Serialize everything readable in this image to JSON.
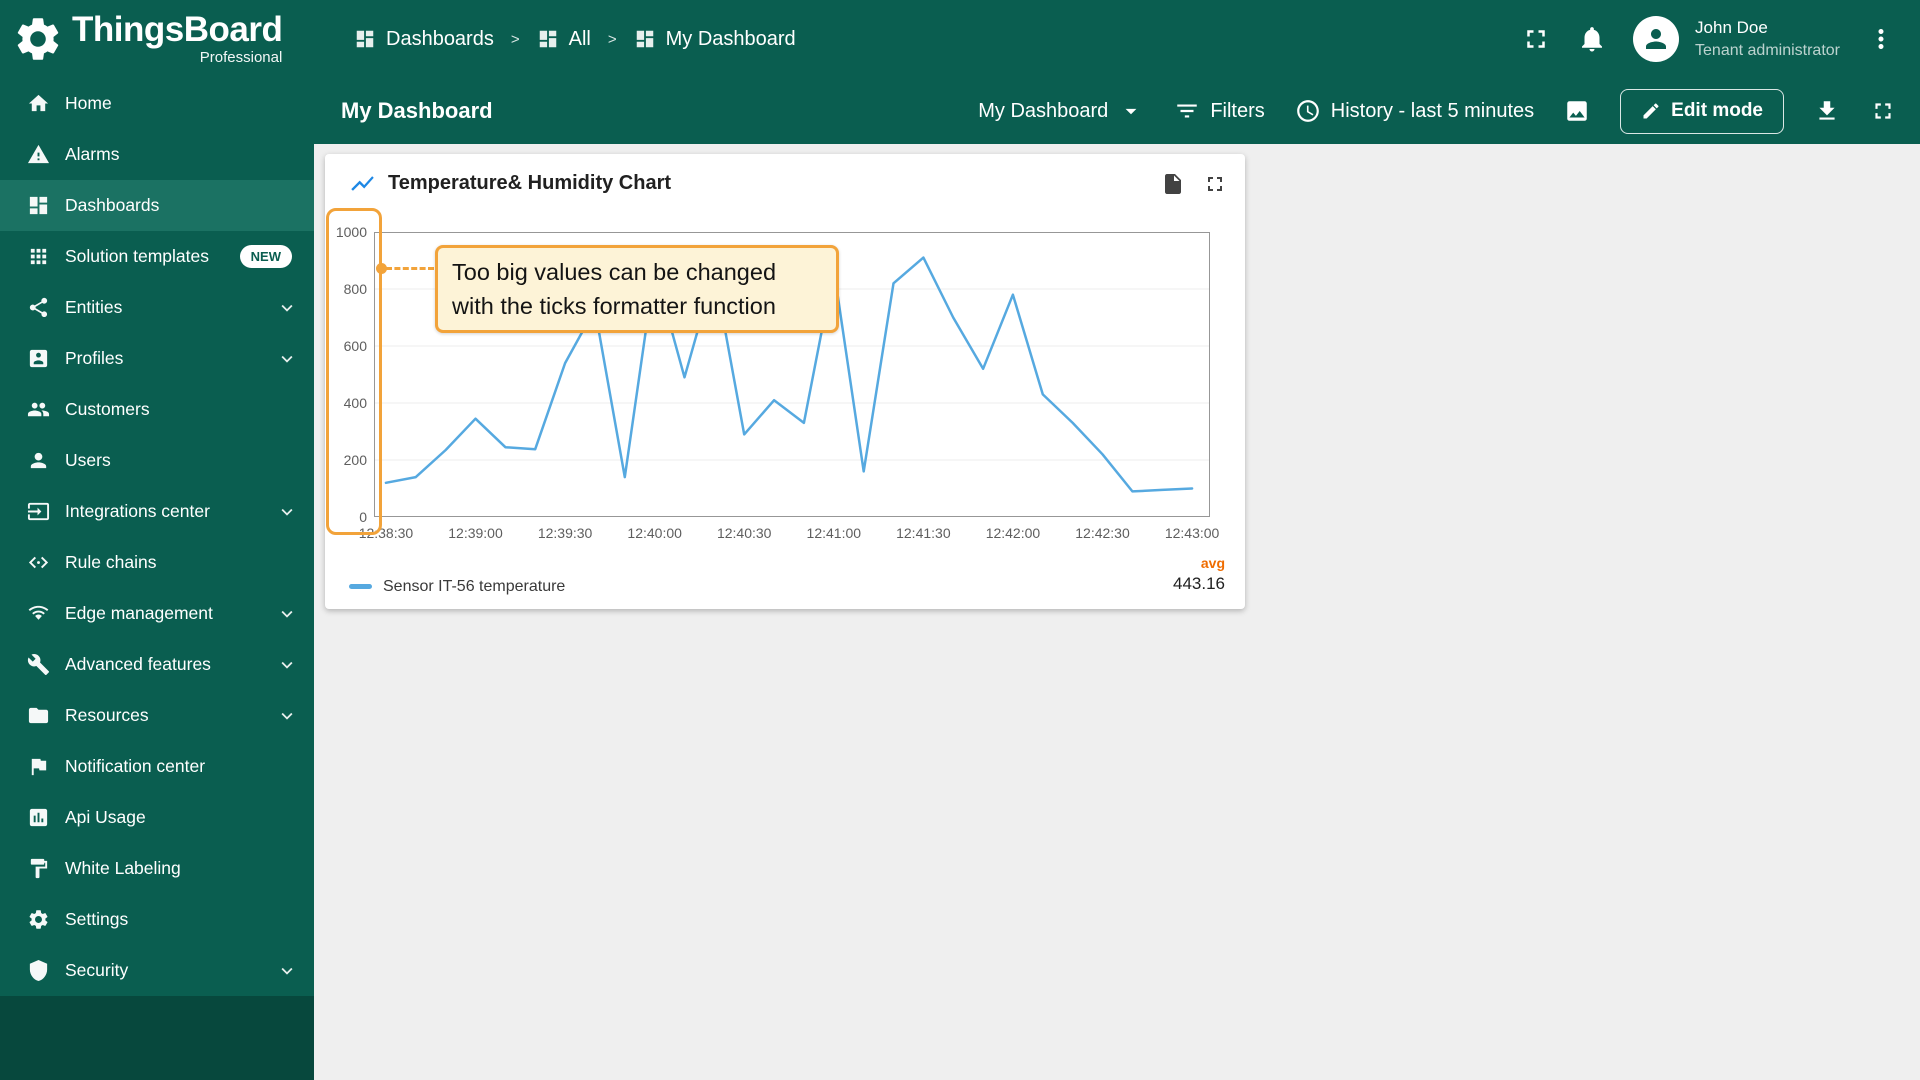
{
  "brand": {
    "title": "ThingsBoard",
    "subtitle": "Professional"
  },
  "colors": {
    "primary": "#0a5e50",
    "primary_active": "#1b7263",
    "accent_orange": "#f2a33a",
    "line_blue": "#56a9e0",
    "avg_orange": "#ef6c00"
  },
  "icons": {
    "logo": "gear-logo",
    "breadcrumb": "dashboard-grid",
    "topbar": [
      "fullscreen",
      "bell",
      "avatar-person",
      "more-vert"
    ],
    "toolbar": [
      "dropdown-arrow",
      "filter-list",
      "clock",
      "image",
      "pencil",
      "download",
      "fullscreen"
    ],
    "widget": [
      "timeseries-line",
      "file-export",
      "fullscreen"
    ]
  },
  "breadcrumb": {
    "separator": ">",
    "items": [
      {
        "label": "Dashboards"
      },
      {
        "label": "All"
      },
      {
        "label": "My Dashboard"
      }
    ]
  },
  "topbar": {
    "user_name": "John Doe",
    "user_role": "Tenant administrator"
  },
  "toolbar": {
    "title": "My Dashboard",
    "dashboard_select": "My Dashboard",
    "filters": "Filters",
    "history": "History - last 5 minutes",
    "edit_mode": "Edit mode"
  },
  "sidebar": {
    "items": [
      {
        "label": "Home"
      },
      {
        "label": "Alarms"
      },
      {
        "label": "Dashboards",
        "active": true
      },
      {
        "label": "Solution templates",
        "badge": "NEW"
      },
      {
        "label": "Entities",
        "expandable": true
      },
      {
        "label": "Profiles",
        "expandable": true
      },
      {
        "label": "Customers"
      },
      {
        "label": "Users"
      },
      {
        "label": "Integrations center",
        "expandable": true
      },
      {
        "label": "Rule chains"
      },
      {
        "label": "Edge management",
        "expandable": true
      },
      {
        "label": "Advanced features",
        "expandable": true
      },
      {
        "label": "Resources",
        "expandable": true
      },
      {
        "label": "Notification center"
      },
      {
        "label": "Api Usage"
      },
      {
        "label": "White Labeling"
      },
      {
        "label": "Settings"
      },
      {
        "label": "Security",
        "expandable": true
      }
    ]
  },
  "widget": {
    "title": "Temperature& Humidity Chart",
    "legend_series": "Sensor IT-56 temperature",
    "agg_label": "avg",
    "agg_value": "443.16",
    "annotation_line1": "Too big values can be changed",
    "annotation_line2": "with the ticks formatter function"
  },
  "chart_data": {
    "type": "line",
    "title": "Temperature& Humidity Chart",
    "legend_position": "bottom",
    "grid": true,
    "ylim": [
      0,
      1000
    ],
    "y_ticks": [
      0,
      200,
      400,
      600,
      800,
      1000
    ],
    "x_labels": [
      "12:38:30",
      "12:39:00",
      "12:39:30",
      "12:40:00",
      "12:40:30",
      "12:41:00",
      "12:41:30",
      "12:42:00",
      "12:42:30",
      "12:43:00"
    ],
    "point_interval_seconds": 10,
    "x_times": [
      "12:38:30",
      "12:38:40",
      "12:38:50",
      "12:39:00",
      "12:39:10",
      "12:39:20",
      "12:39:30",
      "12:39:40",
      "12:39:50",
      "12:40:00",
      "12:40:10",
      "12:40:20",
      "12:40:30",
      "12:40:40",
      "12:40:50",
      "12:41:00",
      "12:41:10",
      "12:41:20",
      "12:41:30",
      "12:41:40",
      "12:41:50",
      "12:42:00",
      "12:42:10",
      "12:42:20",
      "12:42:30",
      "12:42:40",
      "12:42:50",
      "12:43:00"
    ],
    "series": [
      {
        "name": "Sensor IT-56 temperature",
        "color": "#56a9e0",
        "avg": 443.16,
        "values": [
          120,
          140,
          235,
          345,
          245,
          238,
          540,
          730,
          140,
          870,
          490,
          860,
          290,
          410,
          330,
          870,
          160,
          820,
          910,
          700,
          520,
          780,
          430,
          330,
          220,
          90,
          95,
          100
        ]
      }
    ]
  }
}
